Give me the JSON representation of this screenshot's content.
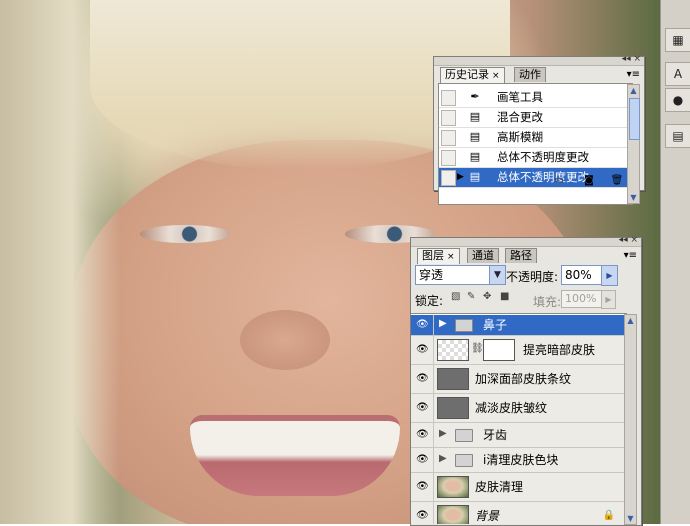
{
  "history_panel": {
    "tabs": [
      {
        "label": "历史记录",
        "active": true,
        "close": "×"
      },
      {
        "label": "动作",
        "active": false
      }
    ],
    "items": [
      {
        "label": "画笔工具",
        "icon": "brush-icon",
        "selected": false
      },
      {
        "label": "混合更改",
        "icon": "document-icon",
        "selected": false
      },
      {
        "label": "高斯模糊",
        "icon": "document-icon",
        "selected": false
      },
      {
        "label": "总体不透明度更改",
        "icon": "document-icon",
        "selected": false
      },
      {
        "label": "总体不透明度更改",
        "icon": "document-icon",
        "selected": true
      }
    ],
    "footer_icons": [
      "new-document-icon",
      "snapshot-camera-icon",
      "trash-icon"
    ]
  },
  "layers_panel": {
    "tabs": [
      {
        "label": "图层",
        "active": true,
        "close": "×"
      },
      {
        "label": "通道",
        "active": false
      },
      {
        "label": "路径",
        "active": false
      }
    ],
    "blend_mode": "穿透",
    "opacity_label": "不透明度:",
    "opacity_value": "80%",
    "lock_label": "锁定:",
    "lock_icons": [
      "lock-transparent-icon",
      "lock-brush-icon",
      "lock-move-icon",
      "lock-all-icon"
    ],
    "fill_label": "填充:",
    "fill_value": "100%",
    "layers": [
      {
        "name": "鼻子",
        "type": "group",
        "selected": true,
        "visible": true
      },
      {
        "name": "提亮暗部皮肤",
        "type": "adjustment-mask",
        "selected": false,
        "visible": true
      },
      {
        "name": "加深面部皮肤条纹",
        "type": "gray",
        "selected": false,
        "visible": true
      },
      {
        "name": "减淡皮肤皱纹",
        "type": "gray",
        "selected": false,
        "visible": true
      },
      {
        "name": "牙齿",
        "type": "group",
        "selected": false,
        "visible": true
      },
      {
        "name": "i清理皮肤色块",
        "type": "group",
        "selected": false,
        "visible": true
      },
      {
        "name": "皮肤清理",
        "type": "photo",
        "selected": false,
        "visible": true
      },
      {
        "name": "背景",
        "type": "photo-locked",
        "selected": false,
        "visible": true
      }
    ]
  },
  "colors": {
    "selection": "#316ac5",
    "panel_bg": "#e8e6e0",
    "accent_field_border": "#7a96c6"
  }
}
